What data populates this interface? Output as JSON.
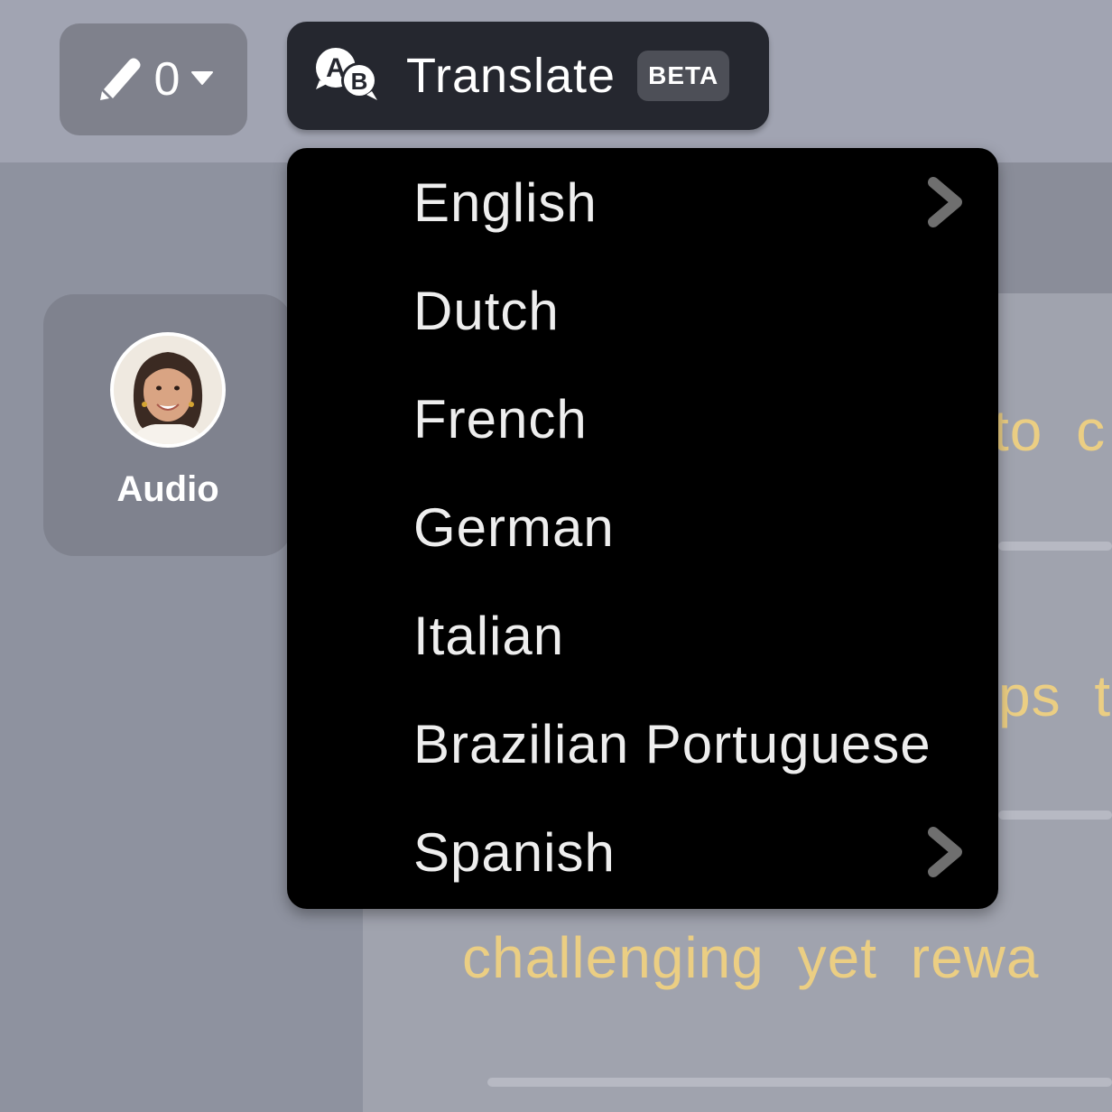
{
  "toolbar": {
    "edit_count": "0",
    "translate_label": "Translate",
    "beta_badge": "BETA"
  },
  "sidebar": {
    "audio_label": "Audio"
  },
  "background_text": {
    "line1": "to c",
    "line2": "ps t",
    "line3": "challenging yet rewa"
  },
  "translate_menu": {
    "items": [
      {
        "label": "English",
        "has_submenu": true
      },
      {
        "label": "Dutch",
        "has_submenu": false
      },
      {
        "label": "French",
        "has_submenu": false
      },
      {
        "label": "German",
        "has_submenu": false
      },
      {
        "label": "Italian",
        "has_submenu": false
      },
      {
        "label": "Brazilian Portuguese",
        "has_submenu": false
      },
      {
        "label": "Spanish",
        "has_submenu": true
      }
    ]
  },
  "colors": {
    "menu_background": "#000000",
    "translate_button": "#25272f",
    "highlight_text": "#ebce83"
  },
  "icons": {
    "edit": "pencil-icon",
    "dropdown": "caret-down-icon",
    "translate": "translate-ab-icon",
    "submenu": "chevron-right-icon"
  }
}
